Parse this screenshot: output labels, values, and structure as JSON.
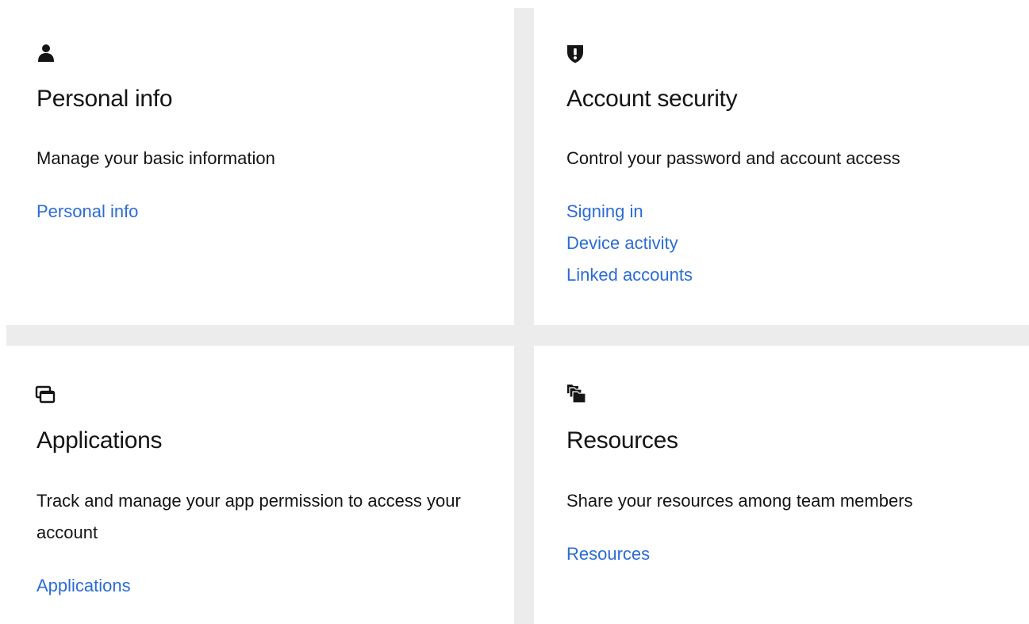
{
  "cards": [
    {
      "icon": "user-icon",
      "title": "Personal info",
      "description": "Manage your basic information",
      "links": [
        "Personal info"
      ]
    },
    {
      "icon": "shield-alert-icon",
      "title": "Account security",
      "description": "Control your password and account access",
      "links": [
        "Signing in",
        "Device activity",
        "Linked accounts"
      ]
    },
    {
      "icon": "applications-window-icon",
      "title": "Applications",
      "description": "Track and manage your app permission to access your account",
      "links": [
        "Applications"
      ]
    },
    {
      "icon": "stacked-folders-icon",
      "title": "Resources",
      "description": "Share your resources among team members",
      "links": [
        "Resources"
      ]
    }
  ],
  "colors": {
    "link": "#2b6cd8",
    "text": "#151515",
    "gutter": "#ececec",
    "card_background": "#ffffff"
  }
}
